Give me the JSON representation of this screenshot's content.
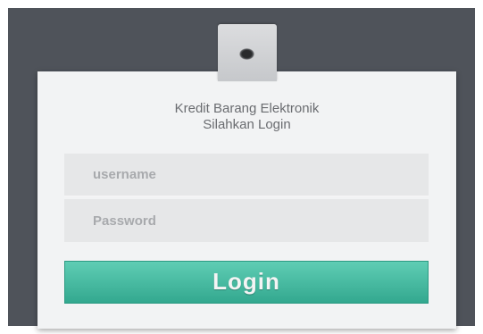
{
  "login_card": {
    "title_line1": "Kredit Barang Elektronik",
    "title_line2": "Silahkan Login",
    "username_placeholder": "username",
    "password_placeholder": "Password",
    "login_label": "Login",
    "icon": "punch-hole-icon"
  },
  "colors": {
    "backdrop": "#4f535a",
    "card": "#f2f3f4",
    "field": "#e6e7e8",
    "button": "#3fb89d",
    "button_text": "#f4f4f4"
  }
}
